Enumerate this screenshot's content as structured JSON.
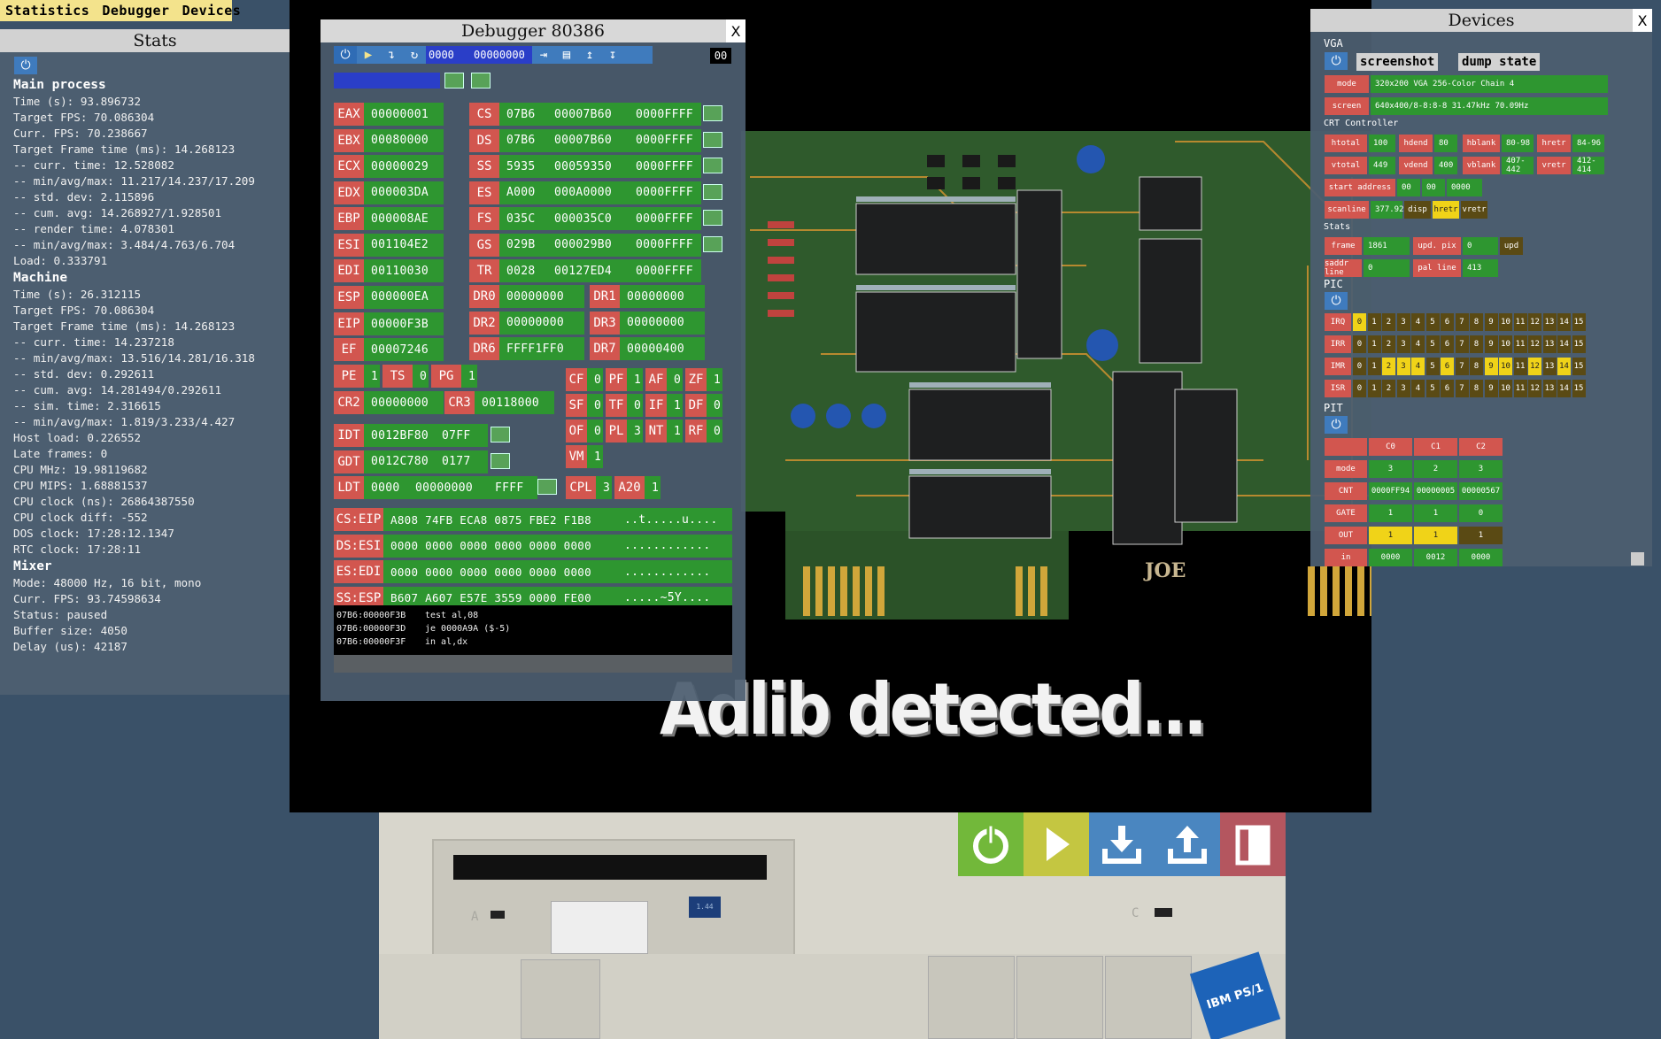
{
  "menu": {
    "items": [
      "Statistics",
      "Debugger",
      "Devices"
    ]
  },
  "stats": {
    "title": "Stats",
    "close": "X",
    "lines": [
      {
        "t": "Main process",
        "sec": true
      },
      {
        "t": "Time (s): 93.896732"
      },
      {
        "t": "Target FPS: 70.086304"
      },
      {
        "t": "Curr. FPS: 70.238667"
      },
      {
        "t": "Target Frame time (ms): 14.268123"
      },
      {
        "t": "-- curr. time: 12.528082"
      },
      {
        "t": "-- min/avg/max: 11.217/14.237/17.209"
      },
      {
        "t": "-- std. dev: 2.115896"
      },
      {
        "t": "-- cum. avg: 14.268927/1.928501"
      },
      {
        "t": "-- render time: 4.078301"
      },
      {
        "t": "-- min/avg/max: 3.484/4.763/6.704"
      },
      {
        "t": "Load: 0.333791"
      },
      {
        "t": "Machine",
        "sec": true
      },
      {
        "t": "Time (s): 26.312115"
      },
      {
        "t": "Target FPS: 70.086304"
      },
      {
        "t": "Target Frame time (ms): 14.268123"
      },
      {
        "t": "-- curr. time: 14.237218"
      },
      {
        "t": "-- min/avg/max: 13.516/14.281/16.318"
      },
      {
        "t": "-- std. dev: 0.292611"
      },
      {
        "t": "-- cum. avg: 14.281494/0.292611"
      },
      {
        "t": "-- sim. time: 2.316615"
      },
      {
        "t": "-- min/avg/max: 1.819/3.233/4.427"
      },
      {
        "t": "Host load: 0.226552"
      },
      {
        "t": "Late frames: 0"
      },
      {
        "t": "CPU MHz: 19.98119682"
      },
      {
        "t": "CPU MIPS: 1.68881537"
      },
      {
        "t": "CPU clock (ns): 26864387550"
      },
      {
        "t": "CPU clock diff: -552"
      },
      {
        "t": "DOS clock: 17:28:12.1347"
      },
      {
        "t": "RTC clock: 17:28:11"
      },
      {
        "t": "Mixer",
        "sec": true
      },
      {
        "t": "Mode: 48000 Hz, 16 bit, mono"
      },
      {
        "t": "Curr. FPS: 93.74598634"
      },
      {
        "t": "Status: paused"
      },
      {
        "t": "Buffer size: 4050"
      },
      {
        "t": "Delay (us): 42187"
      }
    ]
  },
  "debugger": {
    "title": "Debugger 80386",
    "close": "X",
    "addr_seg": "0000",
    "addr_off": "00000000",
    "byte": "00",
    "gp": [
      {
        "n": "EAX",
        "v": "00000001"
      },
      {
        "n": "EBX",
        "v": "00080000"
      },
      {
        "n": "ECX",
        "v": "00000029"
      },
      {
        "n": "EDX",
        "v": "000003DA"
      },
      {
        "n": "EBP",
        "v": "000008AE"
      },
      {
        "n": "ESI",
        "v": "001104E2"
      },
      {
        "n": "EDI",
        "v": "00110030"
      },
      {
        "n": "ESP",
        "v": "000000EA"
      }
    ],
    "seg": [
      {
        "n": "CS",
        "sel": "07B6",
        "base": "00007B60",
        "lim": "0000FFFF"
      },
      {
        "n": "DS",
        "sel": "07B6",
        "base": "00007B60",
        "lim": "0000FFFF"
      },
      {
        "n": "SS",
        "sel": "5935",
        "base": "00059350",
        "lim": "0000FFFF"
      },
      {
        "n": "ES",
        "sel": "A000",
        "base": "000A0000",
        "lim": "0000FFFF"
      },
      {
        "n": "FS",
        "sel": "035C",
        "base": "000035C0",
        "lim": "0000FFFF"
      },
      {
        "n": "GS",
        "sel": "029B",
        "base": "000029B0",
        "lim": "0000FFFF"
      },
      {
        "n": "TR",
        "sel": "0028",
        "base": "00127ED4",
        "lim": "0000FFFF"
      }
    ],
    "dr": [
      {
        "n": "DR0",
        "v": "00000000"
      },
      {
        "n": "DR1",
        "v": "00000000"
      },
      {
        "n": "DR2",
        "v": "00000000"
      },
      {
        "n": "DR3",
        "v": "00000000"
      },
      {
        "n": "DR6",
        "v": "FFFF1FF0"
      },
      {
        "n": "DR7",
        "v": "00000400"
      }
    ],
    "eip": {
      "n": "EIP",
      "v": "00000F3B"
    },
    "ef": {
      "n": "EF",
      "v": "00007246"
    },
    "cr0": [
      {
        "n": "PE",
        "v": "1"
      },
      {
        "n": "TS",
        "v": "0"
      },
      {
        "n": "PG",
        "v": "1"
      }
    ],
    "cr2": {
      "n": "CR2",
      "v": "00000000"
    },
    "cr3": {
      "n": "CR3",
      "v": "00118000"
    },
    "flags": [
      [
        {
          "n": "CF",
          "v": "0"
        },
        {
          "n": "PF",
          "v": "1"
        },
        {
          "n": "AF",
          "v": "0"
        },
        {
          "n": "ZF",
          "v": "1"
        }
      ],
      [
        {
          "n": "SF",
          "v": "0"
        },
        {
          "n": "TF",
          "v": "0"
        },
        {
          "n": "IF",
          "v": "1"
        },
        {
          "n": "DF",
          "v": "0"
        }
      ],
      [
        {
          "n": "OF",
          "v": "0"
        },
        {
          "n": "PL",
          "v": "3"
        },
        {
          "n": "NT",
          "v": "1"
        },
        {
          "n": "RF",
          "v": "0"
        }
      ],
      [
        {
          "n": "VM",
          "v": "1"
        }
      ]
    ],
    "idt": {
      "n": "IDT",
      "base": "0012BF80",
      "lim": "07FF"
    },
    "gdt": {
      "n": "GDT",
      "base": "0012C780",
      "lim": "0177"
    },
    "ldt": {
      "n": "LDT",
      "sel": "0000",
      "base": "00000000",
      "lim": "FFFF"
    },
    "cpl": [
      {
        "n": "CPL",
        "v": "3"
      },
      {
        "n": "A20",
        "v": "1"
      }
    ],
    "mem": [
      {
        "n": "CS:EIP",
        "hex": "A808 74FB ECA8 0875 FBE2 F1B8",
        "asc": "..t.....u...."
      },
      {
        "n": "DS:ESI",
        "hex": "0000 0000 0000 0000 0000 0000",
        "asc": "............"
      },
      {
        "n": "ES:EDI",
        "hex": "0000 0000 0000 0000 0000 0000",
        "asc": "............"
      },
      {
        "n": "SS:ESP",
        "hex": "B607 A607 E57E 3559 0000 FE00",
        "asc": ".....~5Y...."
      }
    ],
    "disasm": [
      {
        "a": "07B6:00000F3B",
        "i": "test al,08"
      },
      {
        "a": "07B6:00000F3D",
        "i": "je 0000A9A ($-5)"
      },
      {
        "a": "07B6:00000F3F",
        "i": "in al,dx"
      }
    ]
  },
  "screen": {
    "message": "Adlib detected...",
    "board_label": "JOE"
  },
  "devices": {
    "title": "Devices",
    "close": "X",
    "vga": {
      "label": "VGA",
      "screenshot": "screenshot",
      "dump": "dump state",
      "mode_l": "mode",
      "mode_v": "320x200 VGA 256-Color Chain 4",
      "screen_l": "screen",
      "screen_v": "640x400/8-8:8-8 31.47kHz 70.09Hz",
      "crt": "CRT Controller",
      "htotal_l": "htotal",
      "htotal": "100",
      "hdend_l": "hdend",
      "hdend": "80",
      "hblank_l": "hblank",
      "hblank": "80-98",
      "hretr_l": "hretr",
      "hretr": "84-96",
      "vtotal_l": "vtotal",
      "vtotal": "449",
      "vdend_l": "vdend",
      "vdend": "400",
      "vblank_l": "vblank",
      "vblank": "407-442",
      "vretr_l": "vretr",
      "vretr": "412-414",
      "start_l": "start address",
      "start_a": "00",
      "start_b": "00",
      "start_c": "0000",
      "scan_l": "scanline",
      "scan_v": "377.92",
      "disp": "disp",
      "hretr2": "hretr",
      "vretr2": "vretr",
      "stats": "Stats",
      "frame_l": "frame",
      "frame_v": "1861",
      "updpix_l": "upd. pix",
      "updpix_v": "0",
      "upd": "upd",
      "saddr_l": "saddr line",
      "saddr_v": "0",
      "pal_l": "pal line",
      "pal_v": "413"
    },
    "pic": {
      "label": "PIC",
      "rows": [
        {
          "n": "IRQ",
          "on": [
            0
          ]
        },
        {
          "n": "IRR",
          "on": []
        },
        {
          "n": "IMR",
          "on": [
            2,
            3,
            4,
            6,
            9,
            10,
            12,
            14
          ]
        },
        {
          "n": "ISR",
          "on": []
        }
      ],
      "nums": [
        "0",
        "1",
        "2",
        "3",
        "4",
        "5",
        "6",
        "7",
        "8",
        "9",
        "10",
        "11",
        "12",
        "13",
        "14",
        "15"
      ]
    },
    "pit": {
      "label": "PIT",
      "cols": [
        "C0",
        "C1",
        "C2"
      ],
      "rows": [
        {
          "n": "mode",
          "v": [
            "3",
            "2",
            "3"
          ],
          "style": [
            "g",
            "g",
            "g"
          ]
        },
        {
          "n": "CNT",
          "v": [
            "0000FF94",
            "00000005",
            "00000567"
          ],
          "style": [
            "g",
            "g",
            "g"
          ]
        },
        {
          "n": "GATE",
          "v": [
            "1",
            "1",
            "0"
          ],
          "style": [
            "g",
            "g",
            "g"
          ]
        },
        {
          "n": "OUT",
          "v": [
            "1",
            "1",
            "1"
          ],
          "style": [
            "y",
            "y",
            "d"
          ]
        },
        {
          "n": "in",
          "v": [
            "0000",
            "0012",
            "0000"
          ],
          "style": [
            "g",
            "g",
            "g"
          ]
        }
      ]
    }
  },
  "drive": {
    "a_label": "A",
    "c_label": "C",
    "disk": "1.44",
    "brand": "IBM PS/1"
  },
  "controls": {
    "colors": {
      "power": "#72b83a",
      "play": "#c4c641",
      "save": "#4a86c0",
      "restore": "#4a86c0",
      "exit": "#b4565f"
    }
  }
}
